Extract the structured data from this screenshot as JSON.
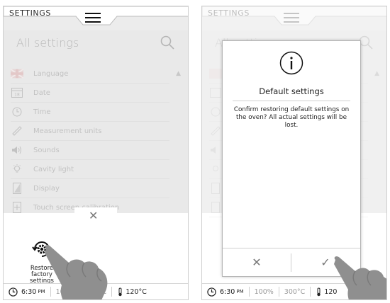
{
  "left_screen": {
    "topbar_title": "SETTINGS",
    "section_title": "All settings",
    "menu_items": [
      {
        "label": "Language",
        "icon": "flag-icon"
      },
      {
        "label": "Date",
        "icon": "calendar-icon"
      },
      {
        "label": "Time",
        "icon": "clock-icon"
      },
      {
        "label": "Measurement units",
        "icon": "ruler-icon"
      },
      {
        "label": "Sounds",
        "icon": "speaker-icon"
      },
      {
        "label": "Cavity light",
        "icon": "lightbulb-icon"
      },
      {
        "label": "Display",
        "icon": "display-icon"
      },
      {
        "label": "Touch screen calibration",
        "icon": "touch-calibration-icon"
      }
    ],
    "calendar_day": "18",
    "restore_label": "Restore factory settings",
    "close_symbol": "✕"
  },
  "right_screen": {
    "topbar_title": "SETTINGS",
    "section_title_partial": "All settings",
    "dialog": {
      "title": "Default settings",
      "message": "Confirm restoring default settings on the oven? All actual settings will be lost.",
      "cancel_symbol": "✕",
      "confirm_symbol": "✓"
    }
  },
  "status_bar": {
    "time": "6:30",
    "ampm": "PM",
    "power": "100%",
    "oven_temp": "300°C",
    "probe_temp": "120°C",
    "probe_temp_short": "120"
  },
  "colors": {
    "overlay_bg": "#e9e9e9",
    "text_dim": "#c2c2c2",
    "hand": "#8f8f8f"
  }
}
